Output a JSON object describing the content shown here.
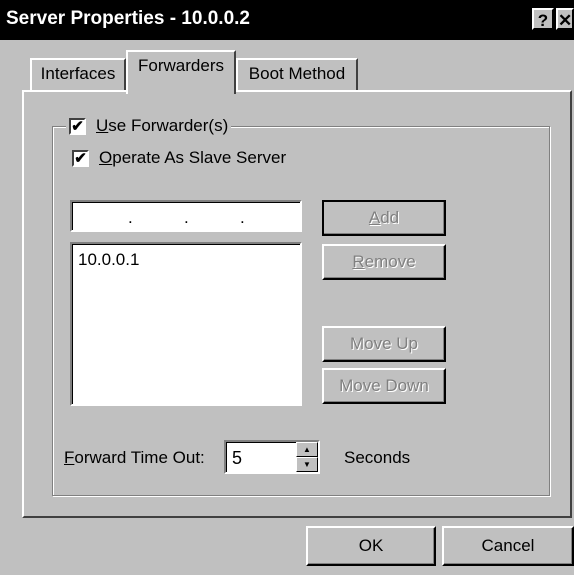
{
  "window": {
    "title": "Server Properties - 10.0.0.2",
    "help_button": "?",
    "close_button": "✕"
  },
  "tabs": [
    {
      "label": "Interfaces"
    },
    {
      "label": "Forwarders",
      "selected": true
    },
    {
      "label": "Boot Method"
    }
  ],
  "forwarders": {
    "use_forwarders": {
      "label_prefix": "",
      "label_u": "U",
      "label_rest": "se Forwarder(s)",
      "checked": true
    },
    "operate_slave": {
      "label_u": "O",
      "label_rest": "perate As Slave Server",
      "checked": true
    },
    "ip_input": {
      "dots": ".   .   ."
    },
    "list_items": [
      "10.0.0.1"
    ],
    "buttons": {
      "add": {
        "label_u": "A",
        "label_rest": "dd"
      },
      "remove": {
        "label_u": "R",
        "label_rest": "emove"
      },
      "move_up": "Move Up",
      "move_down": "Move Down"
    },
    "timeout": {
      "label_u": "F",
      "label_rest": "orward Time Out:",
      "value": "5",
      "units": "Seconds"
    }
  },
  "footer": {
    "ok": "OK",
    "cancel": "Cancel"
  },
  "checkmark": "✔"
}
